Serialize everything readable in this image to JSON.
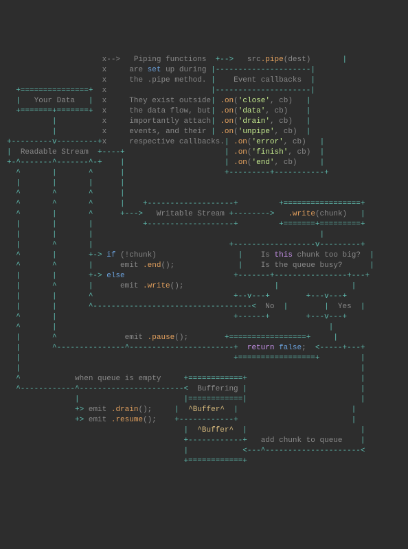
{
  "box_your_data": "Your Data",
  "box_readable": "Readable Stream",
  "box_writable": "Writable Stream",
  "box_buffering": "Buffering",
  "box_no": "No",
  "box_yes": "Yes",
  "piping_l1_a": "Piping functions",
  "piping_l2_a": "are ",
  "piping_l2_set": "set",
  "piping_l2_b": " up during",
  "piping_l3_a": "the .pipe method.",
  "piping_l4_a": "They exist outside",
  "piping_l5_a": "the data flow, but",
  "piping_l6_a": "importantly attach",
  "piping_l7_a": "events, and their",
  "piping_l8_a": "respective callbacks.",
  "src": "src",
  "dot_pipe": ".pipe",
  "dest": "(dest)",
  "cb_header": "Event callbacks",
  "on": ".on",
  "cb_paren_open": "(",
  "cb_close": "'close'",
  "cb_data": "'data'",
  "cb_drain": "'drain'",
  "cb_unpipe": "'unpipe'",
  "cb_error": "'error'",
  "cb_finish": "'finish'",
  "cb_end": "'end'",
  "cb_cb": ", cb)",
  "write_call_dot": ".write",
  "write_call_arg": "(chunk)",
  "q_is": "Is ",
  "q_this": "this",
  "q_chunk_big": " chunk too big?",
  "q_queue_busy": "Is the queue busy?",
  "kw_if": "if",
  "if_cond": " (!chunk)",
  "emit_end_a": "emit ",
  "emit_end_b": ".end",
  "emit_end_c": "();",
  "kw_else": "else",
  "emit_write_a": "emit ",
  "emit_write_b": ".write",
  "emit_write_c": "();",
  "emit_pause_a": "emit ",
  "emit_pause_b": ".pause",
  "emit_pause_c": "();",
  "kw_return": "return",
  "return_tail": " ",
  "kw_false": "false",
  "semi": ";",
  "when_empty": "when queue is empty",
  "emit_drain_a": "emit ",
  "emit_drain_b": ".drain",
  "emit_drain_c": "();",
  "emit_resume_a": "emit ",
  "emit_resume_b": ".resume",
  "emit_resume_c": "();",
  "buf_label": "^Buffer^",
  "add_queue": "add chunk to queue"
}
